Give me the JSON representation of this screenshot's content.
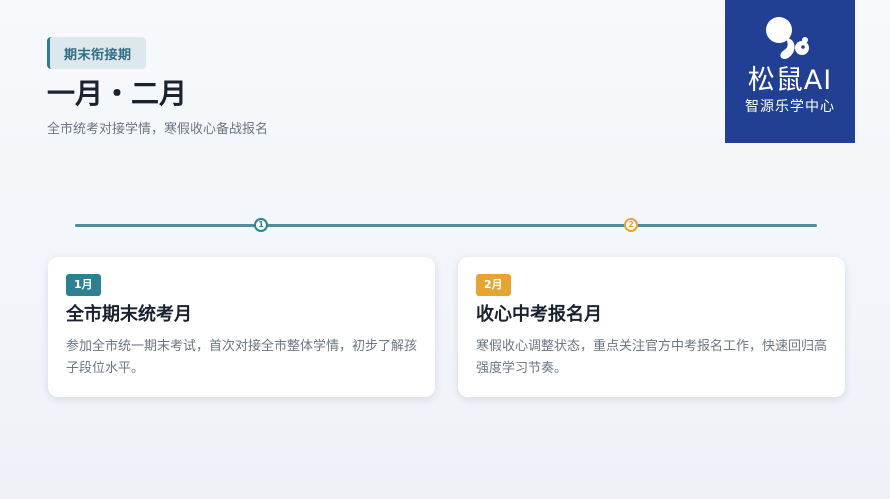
{
  "header": {
    "tag": "期末衔接期",
    "title": "一月・二月",
    "subtitle": "全市统考对接学情，寒假收心备战报名"
  },
  "logo": {
    "name": "松鼠AI",
    "subtitle": "智源乐学中心",
    "background": "#213f93"
  },
  "timeline": {
    "nodes": [
      {
        "label": "1",
        "color": "#2f7f92"
      },
      {
        "label": "2",
        "color": "#e6a532"
      }
    ]
  },
  "cards": [
    {
      "badge": "1月",
      "title": "全市期末统考月",
      "description": "参加全市统一期末考试，首次对接全市整体学情，初步了解孩子段位水平。",
      "accent": "#2f7f92"
    },
    {
      "badge": "2月",
      "title": "收心中考报名月",
      "description": "寒假收心调整状态，重点关注官方中考报名工作，快速回归高强度学习节奏。",
      "accent": "#e6a532"
    }
  ]
}
